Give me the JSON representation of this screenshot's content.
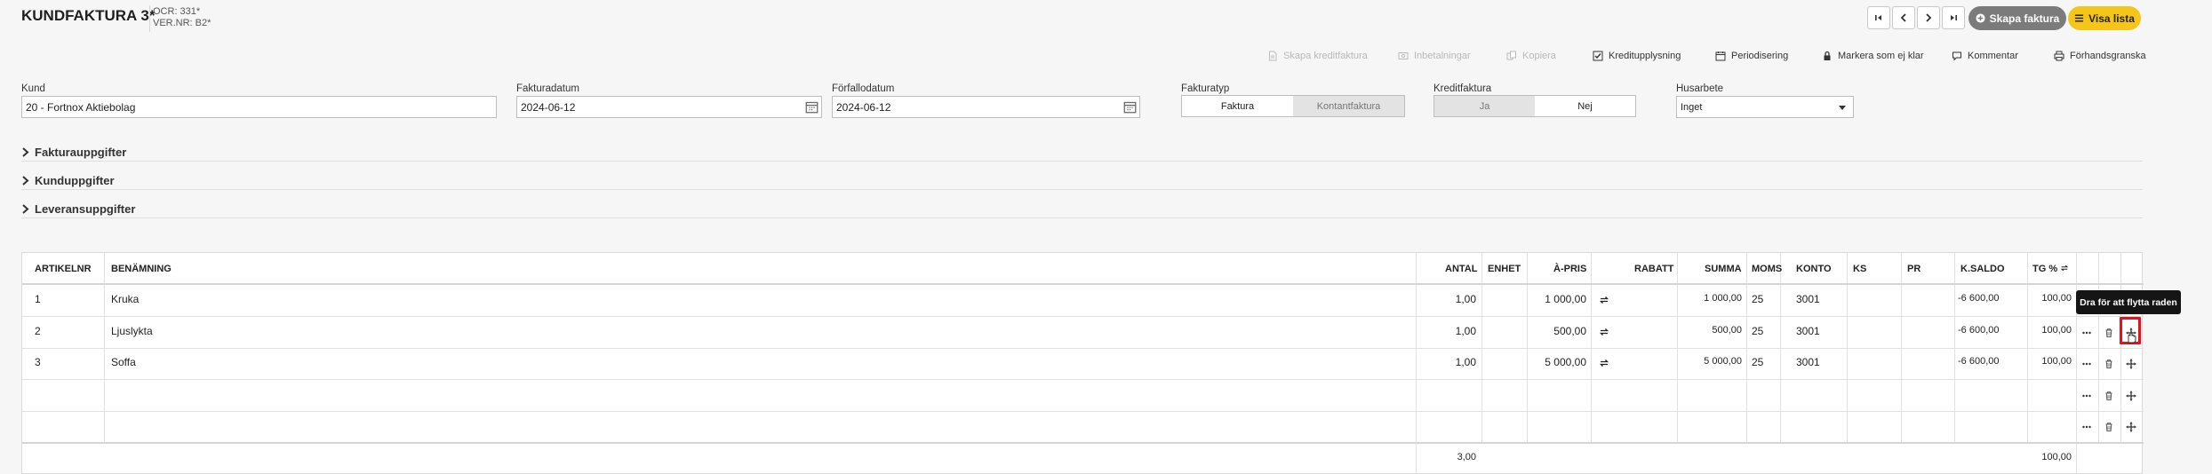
{
  "header": {
    "title": "KUNDFAKTURA 3*",
    "ocr": "OCR: 331*",
    "ver_nr": "VER.NR: B2*",
    "create_invoice": "Skapa faktura",
    "show_list": "Visa lista"
  },
  "toolbar": {
    "create_credit": "Skapa kreditfaktura",
    "payments": "Inbetalningar",
    "copy": "Kopiera",
    "credit_check": "Kreditupplysning",
    "accrual": "Periodisering",
    "mark_unready": "Markera som ej klar",
    "comment": "Kommentar",
    "preview": "Förhandsgranska"
  },
  "form": {
    "customer_label": "Kund",
    "customer_value": "20 - Fortnox Aktiebolag",
    "invoice_date_label": "Fakturadatum",
    "invoice_date_value": "2024-06-12",
    "due_date_label": "Förfallodatum",
    "due_date_value": "2024-06-12",
    "invoice_type_label": "Fakturatyp",
    "invoice_type_options": [
      "Faktura",
      "Kontantfaktura"
    ],
    "credit_invoice_label": "Kreditfaktura",
    "credit_invoice_options": [
      "Ja",
      "Nej"
    ],
    "household_label": "Husarbete",
    "household_value": "Inget"
  },
  "sections": [
    "Fakturauppgifter",
    "Kunduppgifter",
    "Leveransuppgifter"
  ],
  "table": {
    "headers": {
      "artikelnr": "ARTIKELNR",
      "benamning": "BENÄMNING",
      "antal": "ANTAL",
      "enhet": "ENHET",
      "apris": "À-PRIS",
      "rabatt": "RABATT",
      "summa": "SUMMA",
      "moms": "MOMS",
      "konto": "KONTO",
      "ks": "KS",
      "pr": "PR",
      "ksaldo": "K.SALDO",
      "tg": "TG %"
    },
    "rows": [
      {
        "artikelnr": "1",
        "benamning": "Kruka",
        "antal": "1,00",
        "apris": "1 000,00",
        "summa": "1 000,00",
        "moms": "25",
        "konto": "3001",
        "ksaldo": "-6 600,00",
        "tg": "100,00"
      },
      {
        "artikelnr": "2",
        "benamning": "Ljuslykta",
        "antal": "1,00",
        "apris": "500,00",
        "summa": "500,00",
        "moms": "25",
        "konto": "3001",
        "ksaldo": "-6 600,00",
        "tg": "100,00"
      },
      {
        "artikelnr": "3",
        "benamning": "Soffa",
        "antal": "1,00",
        "apris": "5 000,00",
        "summa": "5 000,00",
        "moms": "25",
        "konto": "3001",
        "ksaldo": "-6 600,00",
        "tg": "100,00"
      }
    ],
    "total_antal": "3,00",
    "total_tg": "100,00",
    "tooltip": "Dra för att flytta raden"
  },
  "icons": {
    "first": "first-page-icon",
    "prev": "chevron-left-icon",
    "next": "chevron-right-icon",
    "last": "last-page-icon",
    "more": "more-icon",
    "trash": "trash-icon",
    "move": "move-icon",
    "cycle": "cycle-icon",
    "calendar": "calendar-icon"
  },
  "colors": {
    "accent_yellow": "#f5c518",
    "highlight_red": "#e0141a",
    "tooltip_bg": "#151515"
  }
}
